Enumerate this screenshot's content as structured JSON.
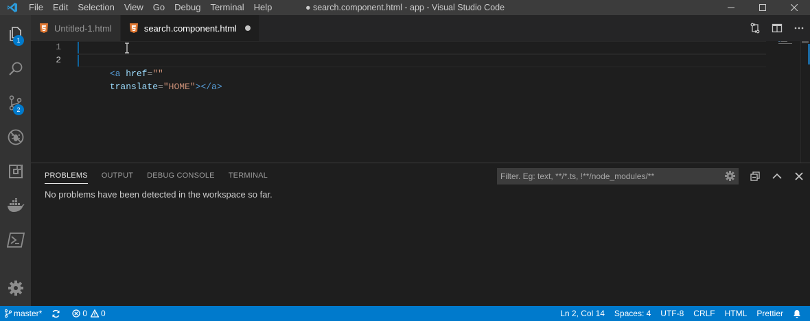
{
  "window": {
    "title": "● search.component.html - app - Visual Studio Code"
  },
  "menu": [
    "File",
    "Edit",
    "Selection",
    "View",
    "Go",
    "Debug",
    "Terminal",
    "Help"
  ],
  "activity_bar": {
    "explorer_badge": "1",
    "scm_badge": "2"
  },
  "tabs": [
    {
      "label": "Untitled-1.html"
    },
    {
      "label": "search.component.html"
    }
  ],
  "editor": {
    "line_numbers": [
      "1",
      "2"
    ],
    "line1": {
      "tag_open": "<a",
      "attr": " href",
      "eq": "=",
      "str": "\"\""
    },
    "line2": {
      "attr": "translate",
      "eq": "=",
      "str": "\"HOME\"",
      "close": "></a>"
    }
  },
  "panel": {
    "tabs": [
      "PROBLEMS",
      "OUTPUT",
      "DEBUG CONSOLE",
      "TERMINAL"
    ],
    "filter_placeholder": "Filter. Eg: text, **/*.ts, !**/node_modules/**",
    "message": "No problems have been detected in the workspace so far."
  },
  "status_bar": {
    "branch": "master*",
    "errors": "0",
    "warnings": "0",
    "position": "Ln 2, Col 14",
    "spaces": "Spaces: 4",
    "encoding": "UTF-8",
    "eol": "CRLF",
    "language": "HTML",
    "formatter": "Prettier"
  },
  "colors": {
    "status_bar": "#007acc",
    "activity_bar": "#333333",
    "editor_bg": "#1e1e1e",
    "html_icon": "#e37933"
  }
}
